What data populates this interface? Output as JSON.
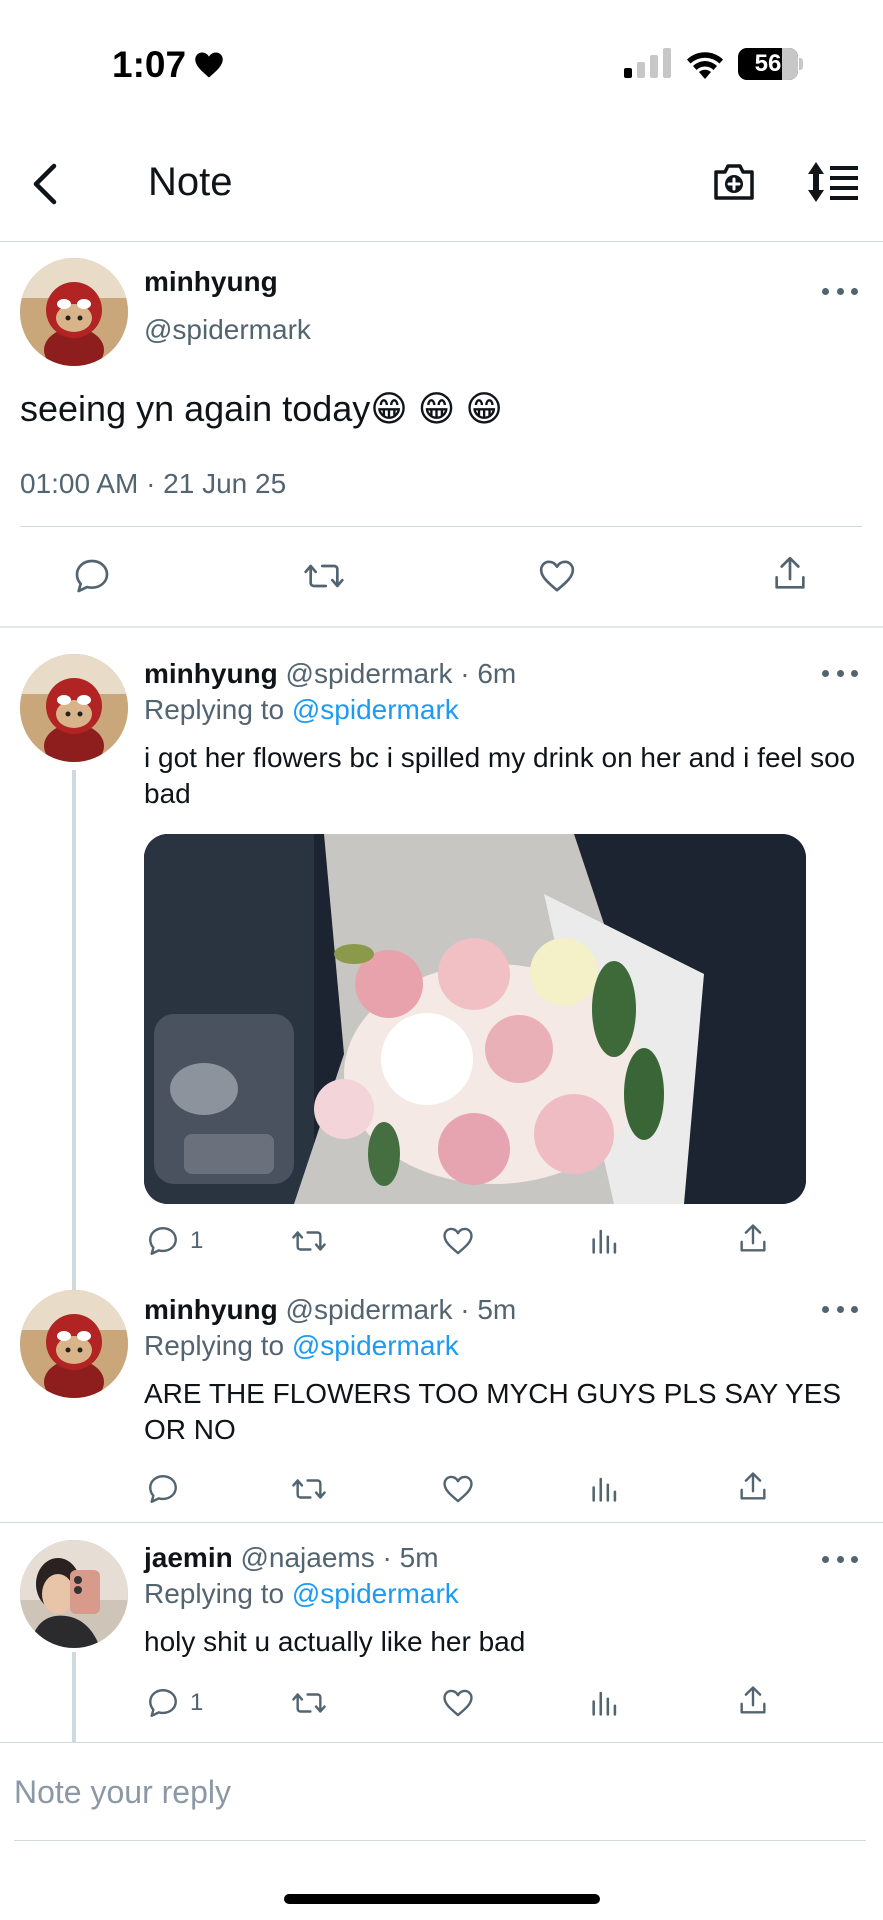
{
  "status_bar": {
    "time": "1:07",
    "battery": "56"
  },
  "header": {
    "title": "Note"
  },
  "main_note": {
    "name": "minhyung",
    "handle": "@spidermark",
    "text": "seeing yn again today😁 😁 😁",
    "timestamp": "01:00 AM · 21 Jun 25"
  },
  "replies": [
    {
      "name": "minhyung",
      "meta": "@spidermark · 6m",
      "replying_label": "Replying to",
      "replying_handle": "@spidermark",
      "text": "i got her flowers bc i spilled my drink on her and i feel soo bad",
      "reply_count": "1",
      "has_photo": true
    },
    {
      "name": "minhyung",
      "meta": "@spidermark · 5m",
      "replying_label": "Replying to",
      "replying_handle": "@spidermark",
      "text": "ARE THE FLOWERS TOO MYCH GUYS PLS SAY YES OR NO",
      "reply_count": ""
    },
    {
      "name": "jaemin",
      "meta": "@najaems · 5m",
      "replying_label": "Replying to",
      "replying_handle": "@spidermark",
      "text": "holy shit u actually like her bad",
      "reply_count": "1"
    }
  ],
  "reply_box": {
    "placeholder": "Note your reply"
  },
  "colors": {
    "accent": "#1d9bf0",
    "secondary_text": "#536471",
    "divider": "#cfd9de"
  }
}
